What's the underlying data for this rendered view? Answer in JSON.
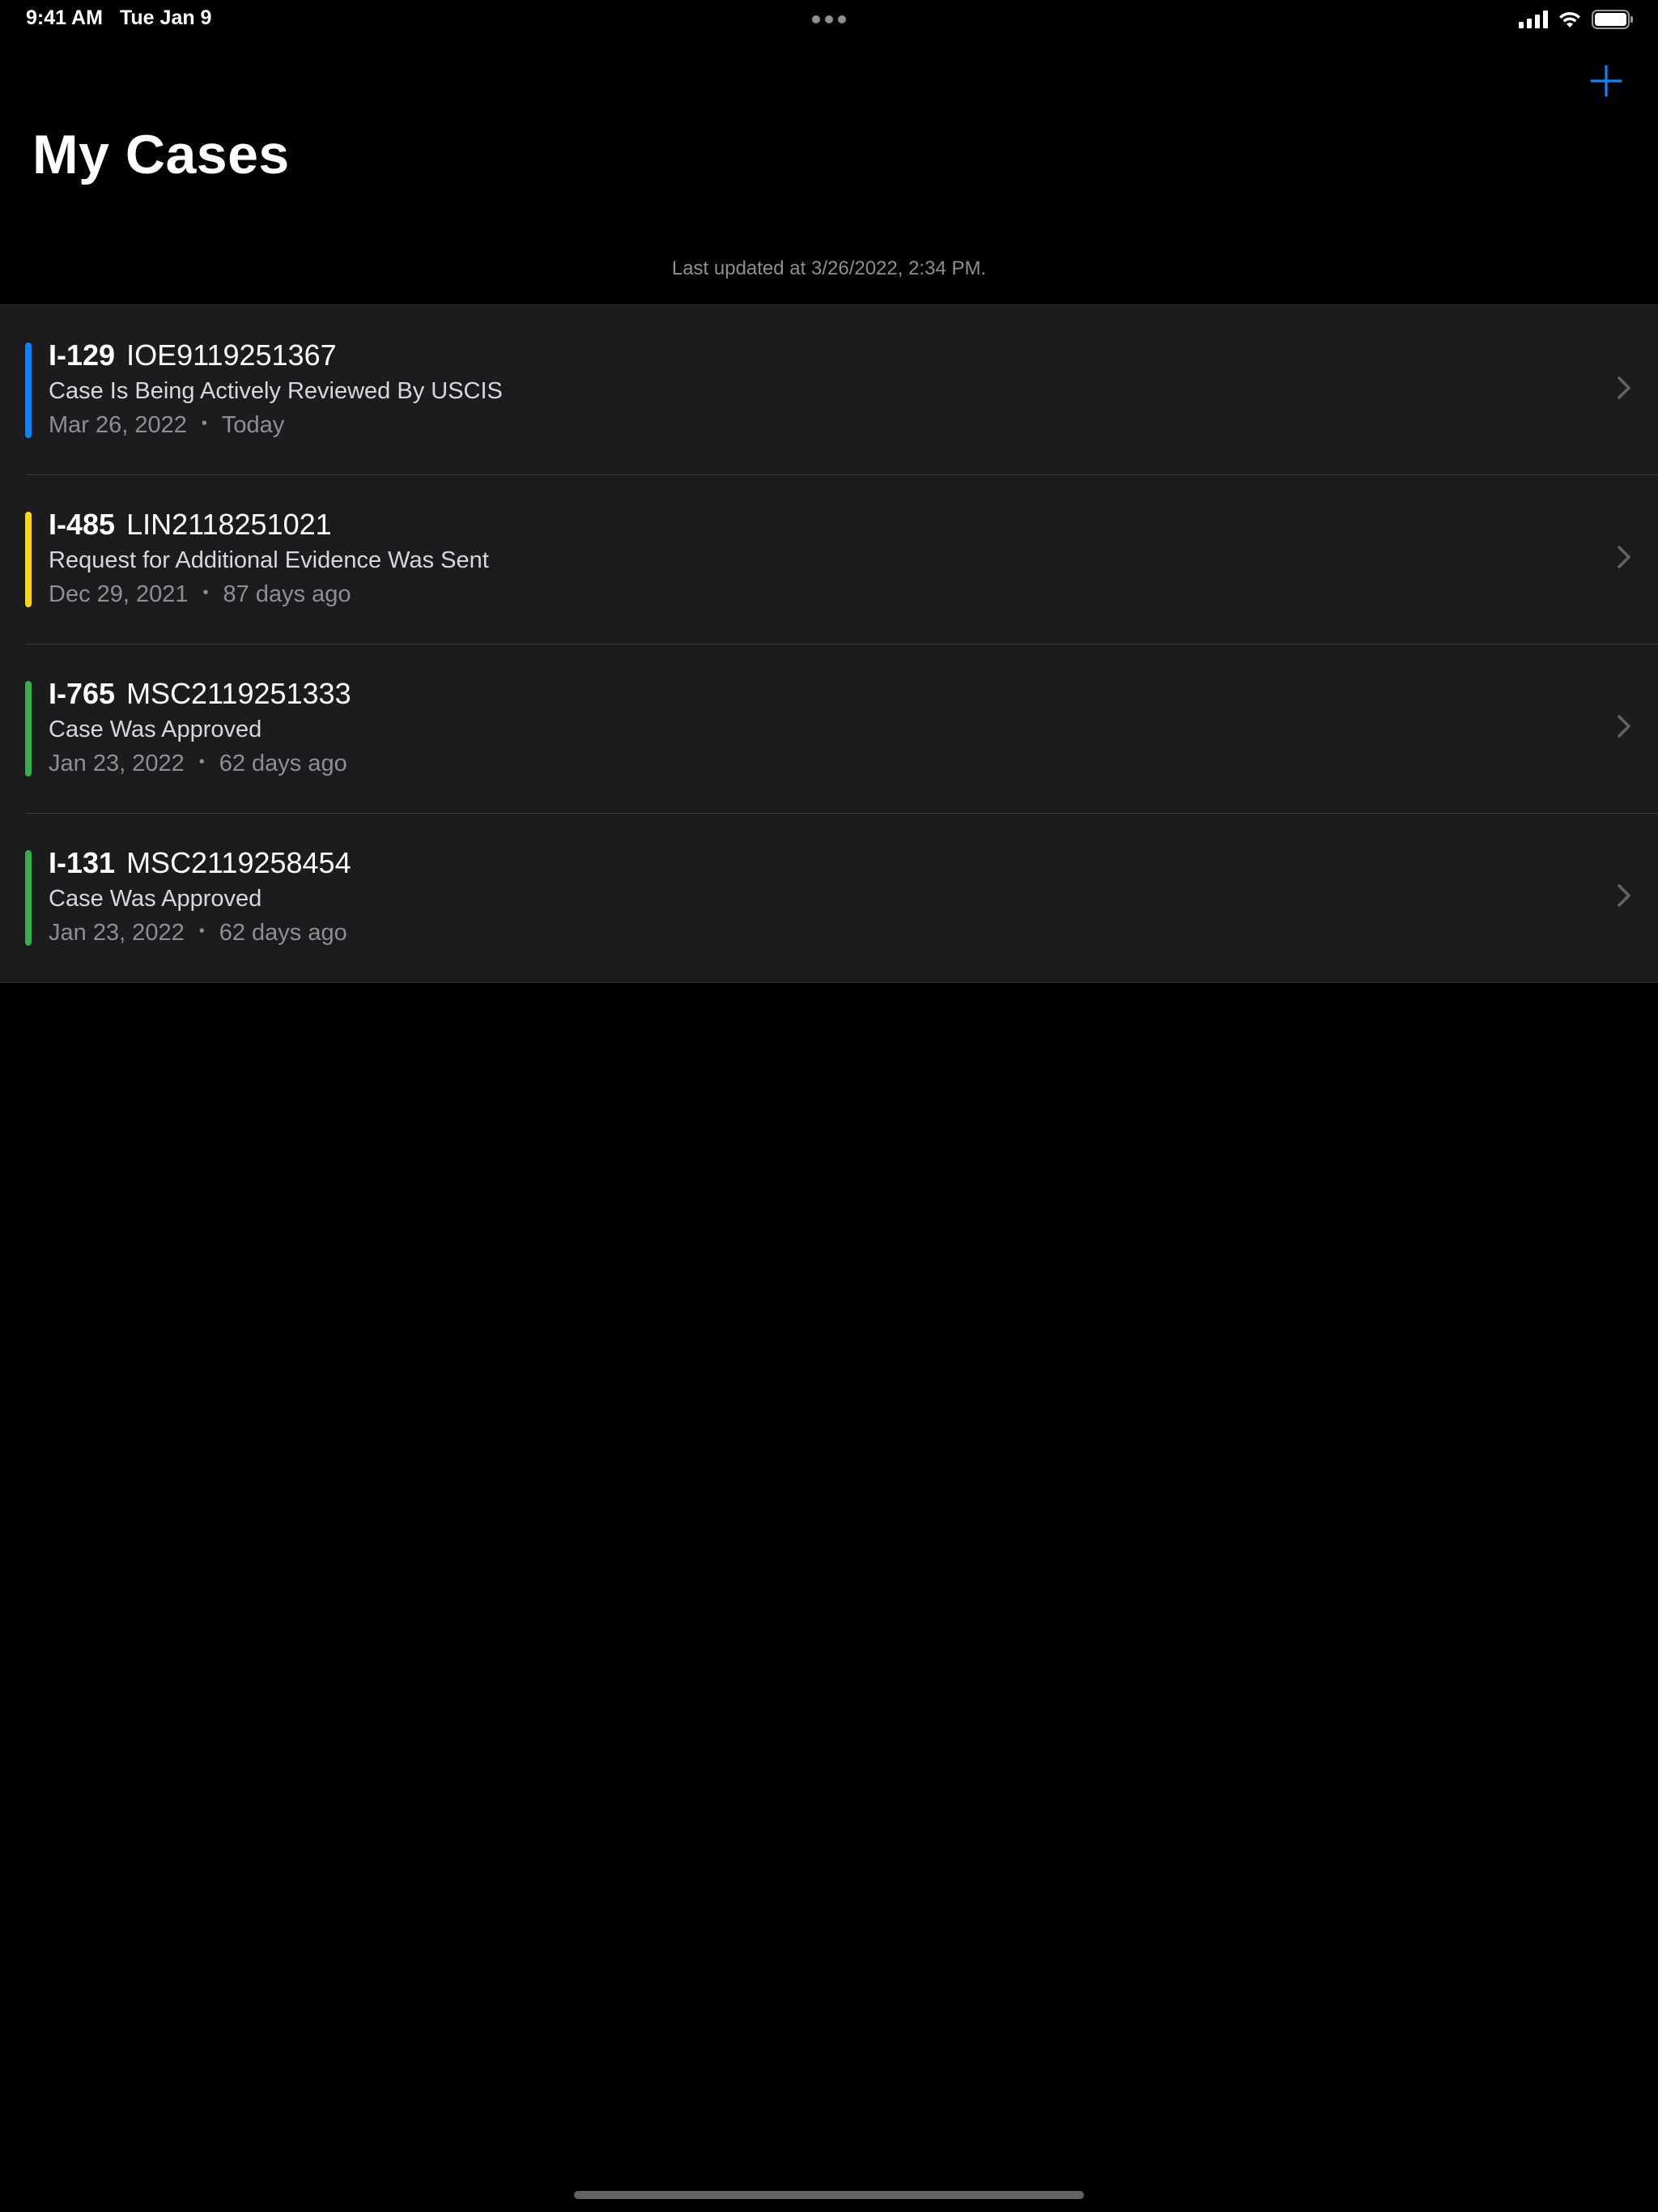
{
  "status_bar": {
    "time": "9:41 AM",
    "date": "Tue Jan 9",
    "icons": [
      "cellular-signal-icon",
      "wifi-icon",
      "battery-icon"
    ]
  },
  "nav": {
    "add_icon": "plus-icon",
    "title": "My Cases"
  },
  "last_updated": "Last updated at 3/26/2022, 2:34 PM.",
  "colors": {
    "accent": "#0a84ff",
    "background": "#000000",
    "row_background": "#1c1c1e",
    "secondary_text": "#8e8e93"
  },
  "cases": [
    {
      "form": "I-129",
      "receipt": "IOE9119251367",
      "status": "Case Is Being Actively Reviewed By USCIS",
      "date": "Mar 26, 2022",
      "separator": "•",
      "age": "Today",
      "stripe_color": "#0a84ff"
    },
    {
      "form": "I-485",
      "receipt": "LIN2118251021",
      "status": "Request for Additional Evidence Was Sent",
      "date": "Dec 29, 2021",
      "separator": "•",
      "age": "87 days ago",
      "stripe_color": "#ffd60a"
    },
    {
      "form": "I-765",
      "receipt": "MSC2119251333",
      "status": "Case Was Approved",
      "date": "Jan 23, 2022",
      "separator": "•",
      "age": "62 days ago",
      "stripe_color": "#30b14c"
    },
    {
      "form": "I-131",
      "receipt": "MSC2119258454",
      "status": "Case Was Approved",
      "date": "Jan 23, 2022",
      "separator": "•",
      "age": "62 days ago",
      "stripe_color": "#30b14c"
    }
  ]
}
